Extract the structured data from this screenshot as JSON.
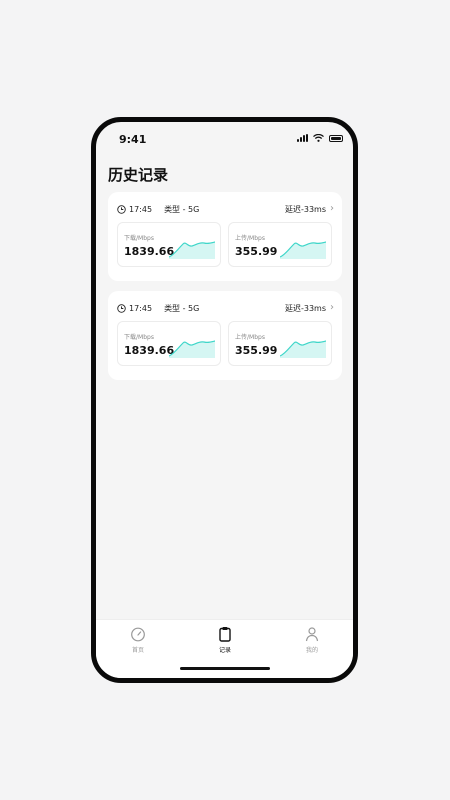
{
  "status_bar": {
    "time": "9:41"
  },
  "page_title": "历史记录",
  "records": [
    {
      "time": "17:45",
      "type": "类型 - 5G",
      "latency": "延迟-33ms",
      "download": {
        "label": "下载/Mbps",
        "value": "1839.66"
      },
      "upload": {
        "label": "上传/Mbps",
        "value": "355.99"
      }
    },
    {
      "time": "17:45",
      "type": "类型 - 5G",
      "latency": "延迟-33ms",
      "download": {
        "label": "下载/Mbps",
        "value": "1839.66"
      },
      "upload": {
        "label": "上传/Mbps",
        "value": "355.99"
      }
    }
  ],
  "tabbar": {
    "tabs": [
      {
        "label": "首页",
        "icon": "speedometer-icon"
      },
      {
        "label": "记录",
        "icon": "clipboard-icon",
        "active": true
      },
      {
        "label": "我的",
        "icon": "person-icon"
      }
    ]
  },
  "colors": {
    "accent": "#3fd6c9",
    "text": "#111111",
    "muted": "#999999"
  }
}
